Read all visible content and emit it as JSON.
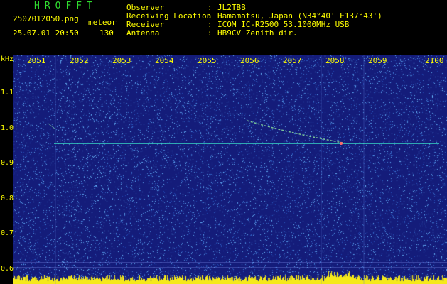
{
  "header": {
    "title": "HROFFT",
    "file_name": "2507012050.png",
    "mode": "meteor",
    "date_time": "25.07.01 20:50",
    "count": "130",
    "info": [
      {
        "key": "Observer",
        "value": "JL2TBB"
      },
      {
        "key": "Receiving Location",
        "value": "Hamamatsu, Japan (N34°40' E137°43')"
      },
      {
        "key": "Receiver",
        "value": "ICOM IC-R2500 53.1000MHz USB"
      },
      {
        "key": "Antenna",
        "value": "HB9CV Zenith dir."
      }
    ],
    "colon": ":"
  },
  "x_axis": {
    "ticks": [
      "2051",
      "2052",
      "2053",
      "2054",
      "2055",
      "2056",
      "2057",
      "2058",
      "2059",
      "2100"
    ]
  },
  "y_axis": {
    "unit": "kHz",
    "ticks": [
      "1.1",
      "1.0",
      "0.9",
      "0.8",
      "0.7",
      "0.6"
    ]
  },
  "colors": {
    "axis_text": "#ffff00",
    "title": "#2fdc2f",
    "background": "#141c7a",
    "noise": "#3c78ff",
    "carrier": "#37d6c4",
    "meteor_trail": "#8ee8a0",
    "bottom_band": "#f5e91a"
  }
}
